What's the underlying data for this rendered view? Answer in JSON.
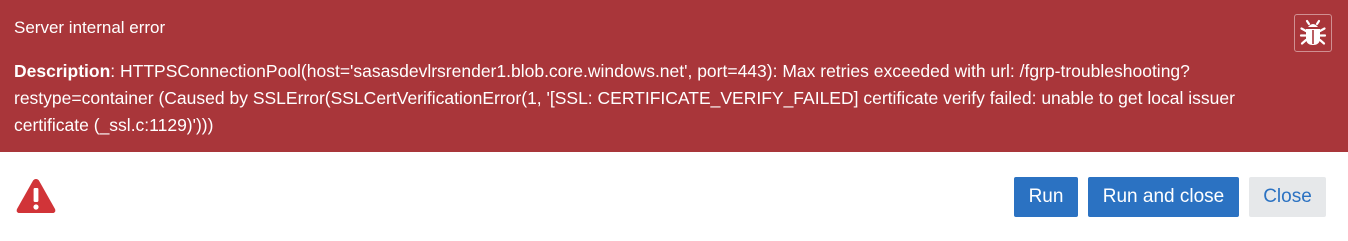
{
  "colors": {
    "banner_background": "#a9363a",
    "primary_button": "#2b72c2",
    "secondary_button": "#e6e8ea",
    "warning_icon": "#d13438"
  },
  "error": {
    "title": "Server internal error",
    "description_label": "Description",
    "description_separator": ": ",
    "description_text": "HTTPSConnectionPool(host='sasasdevlrsrender1.blob.core.windows.net', port=443): Max retries exceeded with url: /fgrp-troubleshooting?restype=container (Caused by SSLError(SSLCertVerificationError(1, '[SSL: CERTIFICATE_VERIFY_FAILED] certificate verify failed: unable to get local issuer certificate (_ssl.c:1129)')))",
    "bug_icon": "bug-icon"
  },
  "footer": {
    "warning_icon": "warning-triangle-icon",
    "buttons": {
      "run": "Run",
      "run_and_close": "Run and close",
      "close": "Close"
    }
  }
}
